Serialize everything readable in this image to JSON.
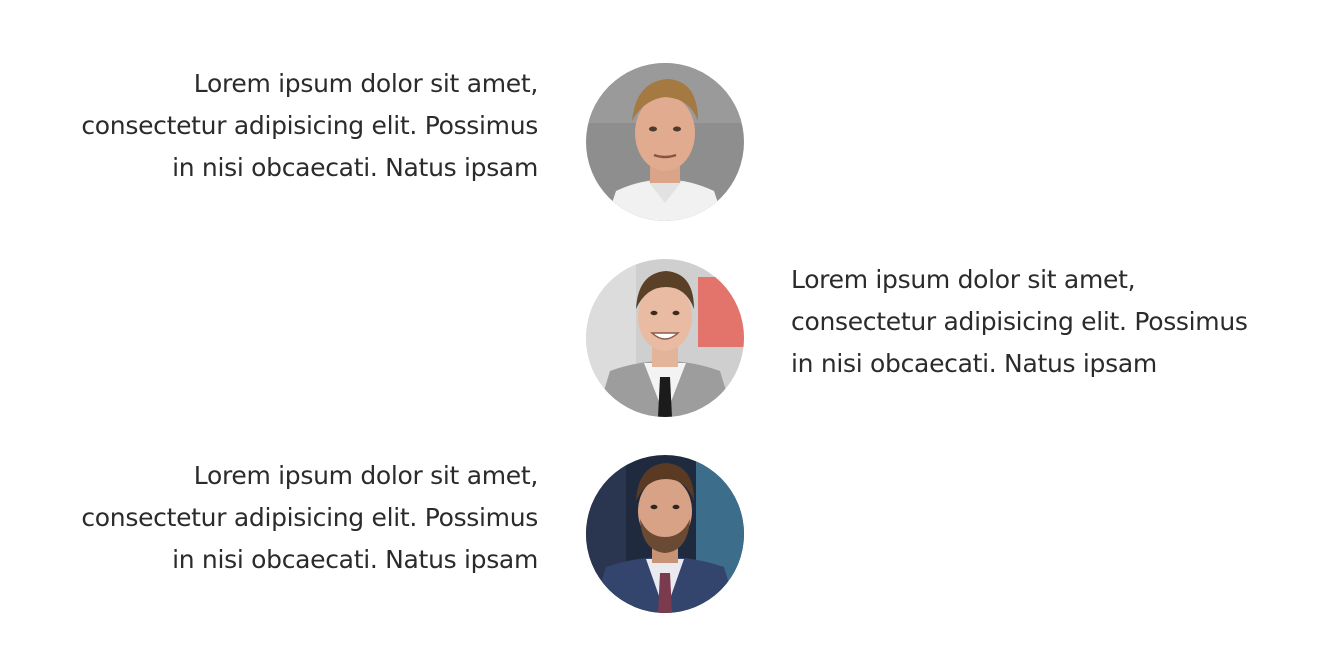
{
  "testimonials": [
    {
      "side": "left",
      "lines": [
        "Lorem ipsum dolor sit amet,",
        "consectetur adipisicing elit. Possimus",
        "in nisi obcaecati. Natus ipsam"
      ],
      "avatar_icon": "person-photo-chef"
    },
    {
      "side": "right",
      "lines": [
        "Lorem ipsum dolor sit amet,",
        "consectetur adipisicing elit. Possimus",
        "in nisi obcaecati. Natus ipsam"
      ],
      "avatar_icon": "person-photo-suit-tie"
    },
    {
      "side": "left",
      "lines": [
        "Lorem ipsum dolor sit amet,",
        "consectetur adipisicing elit. Possimus",
        "in nisi obcaecati. Natus ipsam"
      ],
      "avatar_icon": "person-photo-beard-suit"
    }
  ],
  "colors": {
    "text": "#2b2b2b",
    "background": "#ffffff"
  }
}
